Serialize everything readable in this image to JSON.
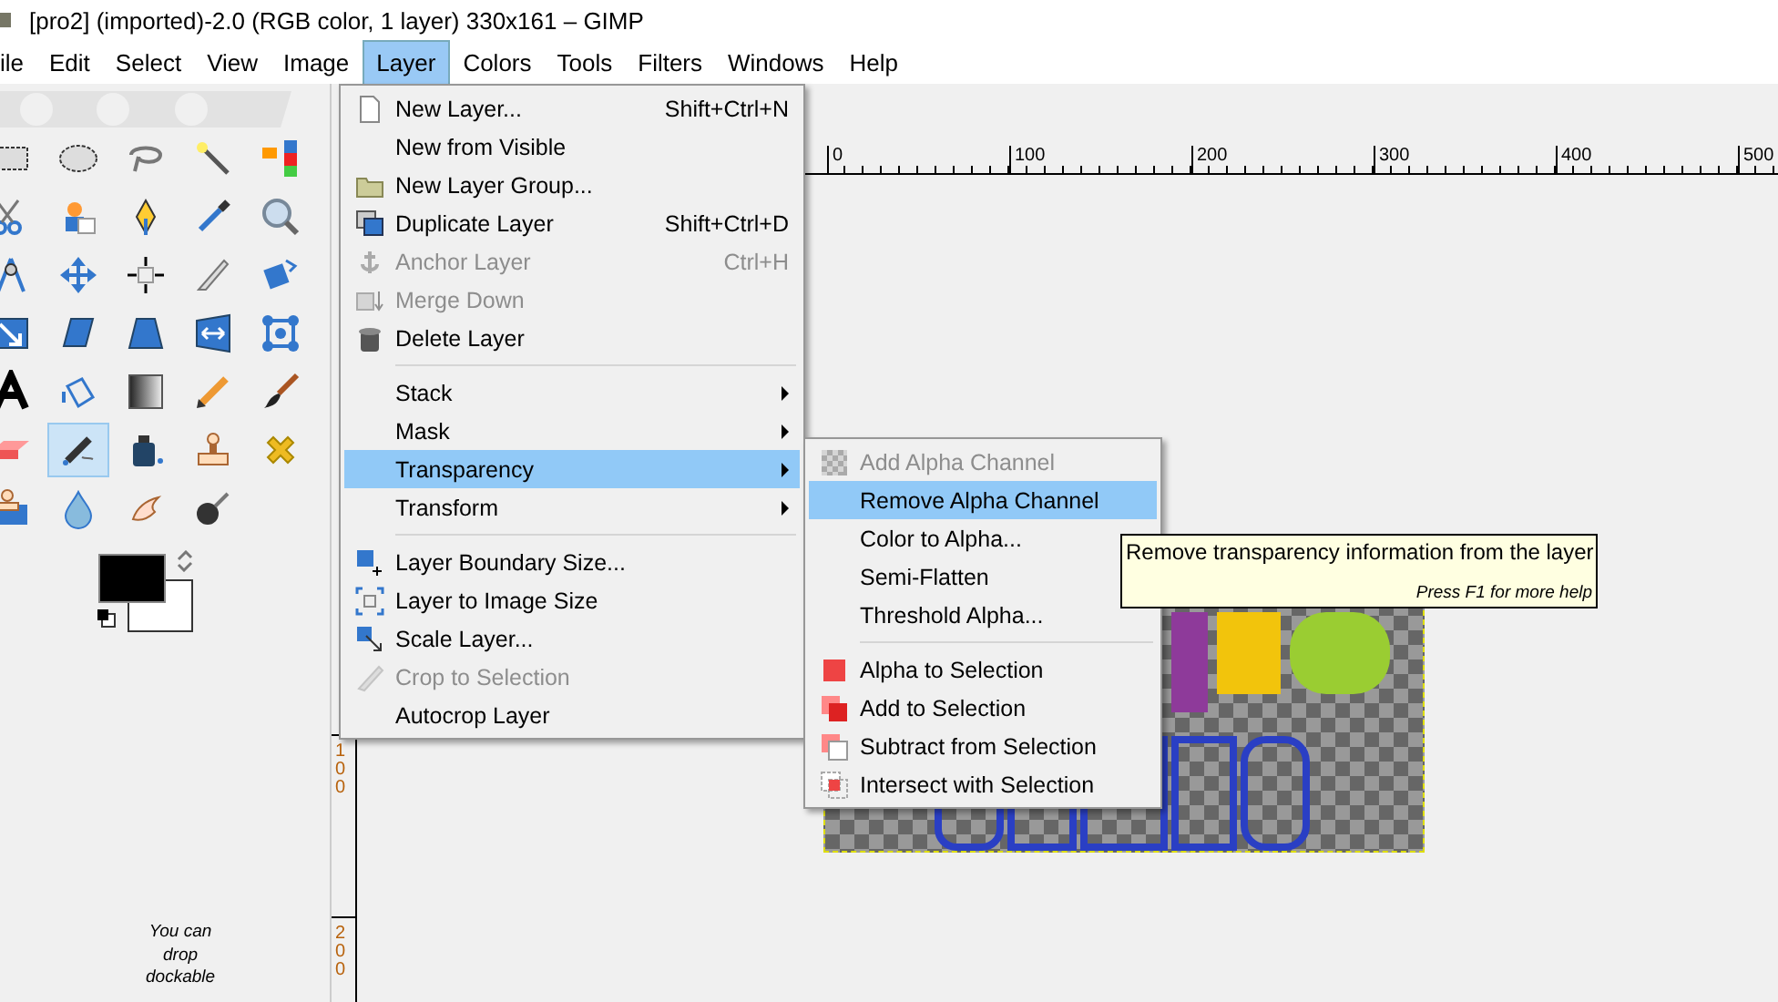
{
  "title_bar": {
    "title": "[pro2] (imported)-2.0 (RGB color, 1 layer) 330x161 – GIMP"
  },
  "menu_bar": {
    "items": [
      {
        "label": "ile",
        "selected": false
      },
      {
        "label": "Edit",
        "selected": false
      },
      {
        "label": "Select",
        "selected": false
      },
      {
        "label": "View",
        "selected": false
      },
      {
        "label": "Image",
        "selected": false
      },
      {
        "label": "Layer",
        "selected": true
      },
      {
        "label": "Colors",
        "selected": false
      },
      {
        "label": "Tools",
        "selected": false
      },
      {
        "label": "Filters",
        "selected": false
      },
      {
        "label": "Windows",
        "selected": false
      },
      {
        "label": "Help",
        "selected": false
      }
    ]
  },
  "toolbox": {
    "tools": [
      {
        "selected": false
      },
      {
        "selected": false
      },
      {
        "selected": false
      },
      {
        "selected": false
      },
      {
        "selected": false
      },
      {
        "selected": false
      },
      {
        "selected": false
      },
      {
        "selected": false
      },
      {
        "selected": false
      },
      {
        "selected": false
      },
      {
        "selected": false
      },
      {
        "selected": false
      },
      {
        "selected": false
      },
      {
        "selected": false
      },
      {
        "selected": false
      },
      {
        "selected": false
      },
      {
        "selected": false
      },
      {
        "selected": false
      },
      {
        "selected": false
      },
      {
        "selected": false
      },
      {
        "selected": false
      },
      {
        "selected": false
      },
      {
        "selected": false
      },
      {
        "selected": false
      },
      {
        "selected": false
      },
      {
        "selected": false
      },
      {
        "selected": true
      },
      {
        "selected": false
      },
      {
        "selected": false
      },
      {
        "selected": false
      },
      {
        "selected": false
      },
      {
        "selected": false
      },
      {
        "selected": false
      },
      {
        "selected": false
      }
    ],
    "drop_hint": "You can drop dockable"
  },
  "rulers": {
    "horizontal": [
      "0",
      "100",
      "200",
      "300",
      "400",
      "500"
    ],
    "vertical": [
      "100",
      "200"
    ]
  },
  "layer_menu": {
    "items": [
      {
        "kind": "item",
        "label": "New Layer...",
        "shortcut": "Shift+Ctrl+N",
        "disabled": false,
        "selected": false,
        "submenu": false
      },
      {
        "kind": "item",
        "label": "New from Visible",
        "disabled": false,
        "selected": false,
        "submenu": false
      },
      {
        "kind": "item",
        "label": "New Layer Group...",
        "disabled": false,
        "selected": false,
        "submenu": false
      },
      {
        "kind": "item",
        "label": "Duplicate Layer",
        "shortcut": "Shift+Ctrl+D",
        "disabled": false,
        "selected": false,
        "submenu": false
      },
      {
        "kind": "item",
        "label": "Anchor Layer",
        "shortcut": "Ctrl+H",
        "disabled": true,
        "selected": false,
        "submenu": false
      },
      {
        "kind": "item",
        "label": "Merge Down",
        "disabled": true,
        "selected": false,
        "submenu": false
      },
      {
        "kind": "item",
        "label": "Delete Layer",
        "disabled": false,
        "selected": false,
        "submenu": false
      },
      {
        "kind": "separator"
      },
      {
        "kind": "item",
        "label": "Stack",
        "disabled": false,
        "selected": false,
        "submenu": true
      },
      {
        "kind": "item",
        "label": "Mask",
        "disabled": false,
        "selected": false,
        "submenu": true
      },
      {
        "kind": "item",
        "label": "Transparency",
        "disabled": false,
        "selected": true,
        "submenu": true
      },
      {
        "kind": "item",
        "label": "Transform",
        "disabled": false,
        "selected": false,
        "submenu": true
      },
      {
        "kind": "separator"
      },
      {
        "kind": "item",
        "label": "Layer Boundary Size...",
        "disabled": false,
        "selected": false,
        "submenu": false
      },
      {
        "kind": "item",
        "label": "Layer to Image Size",
        "disabled": false,
        "selected": false,
        "submenu": false
      },
      {
        "kind": "item",
        "label": "Scale Layer...",
        "disabled": false,
        "selected": false,
        "submenu": false
      },
      {
        "kind": "item",
        "label": "Crop to Selection",
        "disabled": true,
        "selected": false,
        "submenu": false
      },
      {
        "kind": "item",
        "label": "Autocrop Layer",
        "disabled": false,
        "selected": false,
        "submenu": false
      }
    ]
  },
  "transparency_submenu": {
    "items": [
      {
        "kind": "item",
        "label": "Add Alpha Channel",
        "disabled": true,
        "selected": false,
        "submenu": false
      },
      {
        "kind": "item",
        "label": "Remove Alpha Channel",
        "disabled": false,
        "selected": true,
        "submenu": false
      },
      {
        "kind": "item",
        "label": "Color to Alpha...",
        "disabled": false,
        "selected": false,
        "submenu": false
      },
      {
        "kind": "item",
        "label": "Semi-Flatten",
        "disabled": false,
        "selected": false,
        "submenu": false
      },
      {
        "kind": "item",
        "label": "Threshold Alpha...",
        "disabled": false,
        "selected": false,
        "submenu": false
      },
      {
        "kind": "separator"
      },
      {
        "kind": "item",
        "label": "Alpha to Selection",
        "disabled": false,
        "selected": false,
        "submenu": false
      },
      {
        "kind": "item",
        "label": "Add to Selection",
        "disabled": false,
        "selected": false,
        "submenu": false
      },
      {
        "kind": "item",
        "label": "Subtract from Selection",
        "disabled": false,
        "selected": false,
        "submenu": false
      },
      {
        "kind": "item",
        "label": "Intersect with Selection",
        "disabled": false,
        "selected": false,
        "submenu": false
      }
    ]
  },
  "tooltip": {
    "text": "Remove transparency information from the layer",
    "help_hint": "Press F1 for more help"
  }
}
